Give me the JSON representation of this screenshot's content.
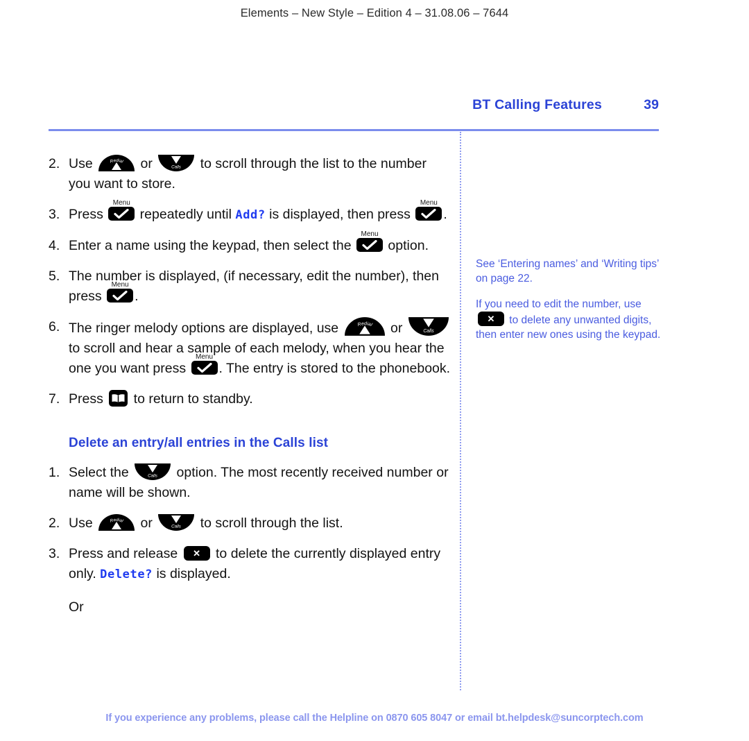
{
  "running_head": "Elements – New Style – Edition 4 – 31.08.06 – 7644",
  "header": {
    "chapter": "BT Calling Features",
    "page_number": "39",
    "rule_color": "#7b8ced",
    "accent_color": "#2b43d6"
  },
  "icons": {
    "redial": {
      "name": "redial-key-icon",
      "label": "Redial"
    },
    "calls": {
      "name": "calls-key-icon",
      "label": "Calls"
    },
    "menu": {
      "name": "menu-key-icon",
      "label": "Menu"
    },
    "delete": {
      "name": "delete-key-icon",
      "glyph": "✕"
    },
    "phonebook": {
      "name": "phonebook-key-icon",
      "glyph": "open-book"
    }
  },
  "main": {
    "steps_continued": [
      {
        "number": "2.",
        "segments": [
          {
            "type": "text",
            "value": "Use "
          },
          {
            "type": "icon",
            "value": "redial"
          },
          {
            "type": "text",
            "value": " or "
          },
          {
            "type": "icon",
            "value": "calls"
          },
          {
            "type": "text",
            "value": " to scroll through the list to the number you want to store."
          }
        ]
      },
      {
        "number": "3.",
        "segments": [
          {
            "type": "text",
            "value": "Press "
          },
          {
            "type": "icon",
            "value": "menu"
          },
          {
            "type": "text",
            "value": " repeatedly until "
          },
          {
            "type": "lcd",
            "value": "Add?"
          },
          {
            "type": "text",
            "value": " is displayed, then press "
          },
          {
            "type": "icon",
            "value": "menu"
          },
          {
            "type": "text",
            "value": "."
          }
        ]
      },
      {
        "number": "4.",
        "segments": [
          {
            "type": "text",
            "value": "Enter a name using the keypad, then select the "
          },
          {
            "type": "icon",
            "value": "menu"
          },
          {
            "type": "text",
            "value": " option."
          }
        ]
      },
      {
        "number": "5.",
        "segments": [
          {
            "type": "text",
            "value": "The number is displayed, (if necessary, edit the number), then press "
          },
          {
            "type": "icon",
            "value": "menu"
          },
          {
            "type": "text",
            "value": "."
          }
        ]
      },
      {
        "number": "6.",
        "segments": [
          {
            "type": "text",
            "value": "The ringer melody options are displayed, use "
          },
          {
            "type": "icon",
            "value": "redial-big"
          },
          {
            "type": "text",
            "value": " or "
          },
          {
            "type": "icon",
            "value": "calls-big"
          },
          {
            "type": "text",
            "value": " to scroll and hear a sample of each melody, when you hear the one you want press "
          },
          {
            "type": "icon",
            "value": "menu"
          },
          {
            "type": "text",
            "value": ". The entry is stored to the phonebook."
          }
        ]
      },
      {
        "number": "7.",
        "segments": [
          {
            "type": "text",
            "value": "Press "
          },
          {
            "type": "icon",
            "value": "phonebook"
          },
          {
            "type": "text",
            "value": " to return to standby."
          }
        ]
      }
    ],
    "section_heading": "Delete an entry/all entries in the Calls list",
    "steps_delete": [
      {
        "number": "1.",
        "segments": [
          {
            "type": "text",
            "value": "Select the "
          },
          {
            "type": "icon",
            "value": "calls"
          },
          {
            "type": "text",
            "value": " option. The most recently received number or name will be shown."
          }
        ]
      },
      {
        "number": "2.",
        "segments": [
          {
            "type": "text",
            "value": "Use "
          },
          {
            "type": "icon",
            "value": "redial"
          },
          {
            "type": "text",
            "value": " or "
          },
          {
            "type": "icon",
            "value": "calls"
          },
          {
            "type": "text",
            "value": " to scroll through the list."
          }
        ]
      },
      {
        "number": "3.",
        "segments": [
          {
            "type": "text",
            "value": "Press and release "
          },
          {
            "type": "icon",
            "value": "delete"
          },
          {
            "type": "text",
            "value": " to delete the currently displayed entry only. "
          },
          {
            "type": "lcd",
            "value": "Delete?"
          },
          {
            "type": "text",
            "value": " is displayed."
          }
        ]
      }
    ],
    "or_label": "Or"
  },
  "sidebar": {
    "notes": [
      {
        "segments": [
          {
            "type": "text",
            "value": "See ‘Entering names’ and ‘Writing tips’ on page 22."
          }
        ]
      },
      {
        "segments": [
          {
            "type": "text",
            "value": "If you need to edit the number, use "
          },
          {
            "type": "icon",
            "value": "delete"
          },
          {
            "type": "text",
            "value": " to delete any unwanted digits, then enter new ones using the keypad."
          }
        ]
      }
    ],
    "color": "#4a5ce0"
  },
  "footer": {
    "text": "If you experience any problems, please call the Helpline on 0870 605 8047 or email bt.helpdesk@suncorptech.com",
    "color": "#8b96ee"
  }
}
